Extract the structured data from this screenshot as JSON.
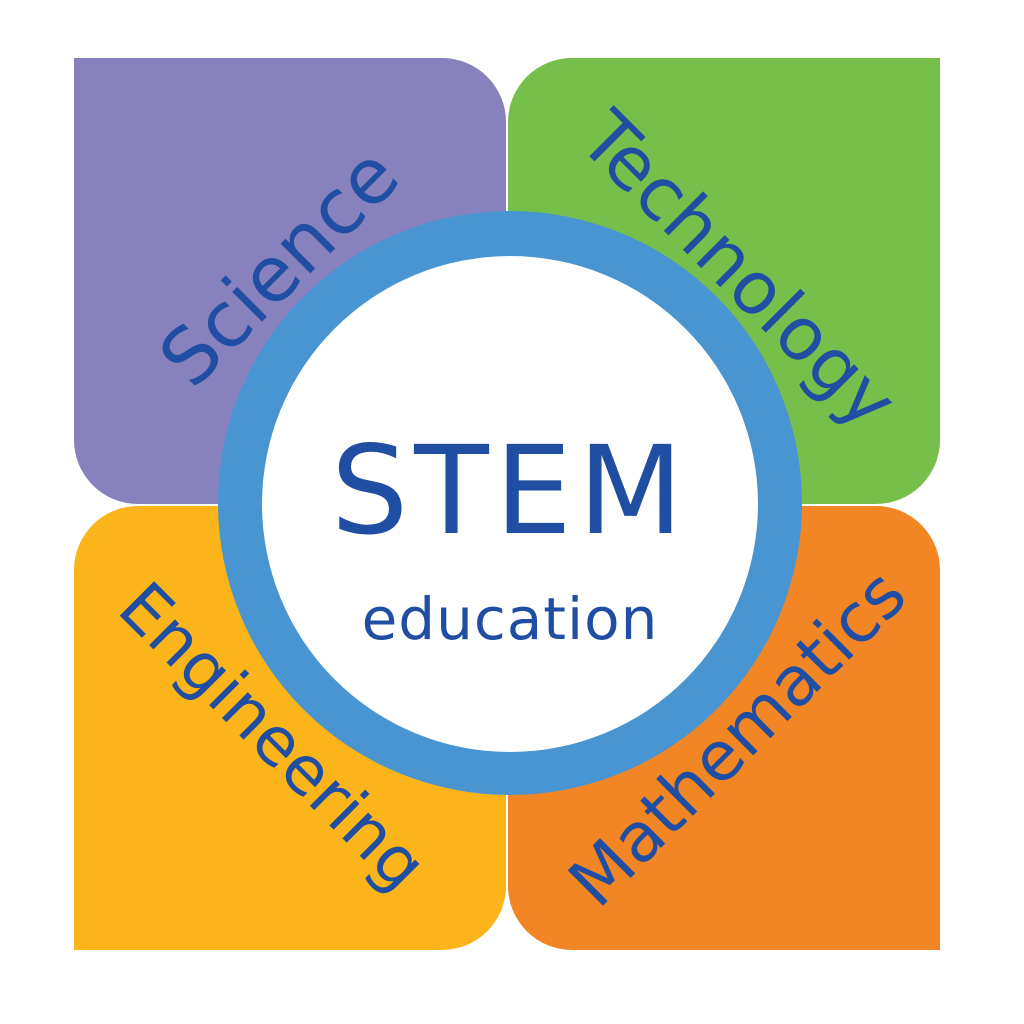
{
  "colors": {
    "science": "#8782bd",
    "technology": "#75bf4a",
    "engineering": "#fbb51b",
    "mathematics": "#f28625",
    "ring": "#4895d1",
    "text": "#1f4ea2",
    "background": "#ffffff"
  },
  "quadrants": [
    {
      "label": "Science"
    },
    {
      "label": "Technology"
    },
    {
      "label": "Engineering"
    },
    {
      "label": "Mathematics"
    }
  ],
  "hub": {
    "title": "STEM",
    "subtitle": "education"
  }
}
